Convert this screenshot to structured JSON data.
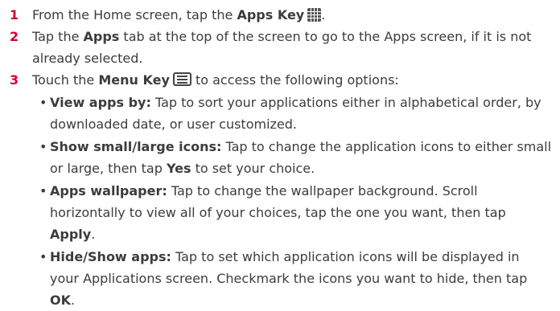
{
  "steps": [
    {
      "num": "1",
      "pre": "From the Home screen, tap the ",
      "bold": "Apps Key",
      "post": "."
    },
    {
      "num": "2",
      "pre": "Tap the ",
      "bold": "Apps",
      "post": " tab at the top of the screen to go to the Apps screen, if it is not already selected."
    },
    {
      "num": "3",
      "pre": "Touch the ",
      "bold": "Menu Key",
      "post": " to access the following options:"
    }
  ],
  "options": [
    {
      "label": "View apps by:",
      "text": " Tap to sort your applications either in alphabetical order, by downloaded date, or user customized."
    },
    {
      "label": "Show small/large icons:",
      "text": " Tap to change the application icons to either small or large, then tap ",
      "bold2": "Yes",
      "text2": " to set your choice."
    },
    {
      "label": "Apps wallpaper:",
      "text": " Tap to change the wallpaper background. Scroll horizontally to view all of your choices, tap the one you want, then tap ",
      "bold2": "Apply",
      "text2": "."
    },
    {
      "label": "Hide/Show apps:",
      "text": " Tap to set which application icons will be displayed in your Applications screen. Checkmark the icons you want to hide, then tap ",
      "bold2": "OK",
      "text2": "."
    }
  ],
  "icons": {
    "apps_key": "apps-grid-icon",
    "menu_key": "menu-key-icon"
  },
  "colors": {
    "step_number": "#d2002e",
    "text": "#3c3c3c"
  }
}
